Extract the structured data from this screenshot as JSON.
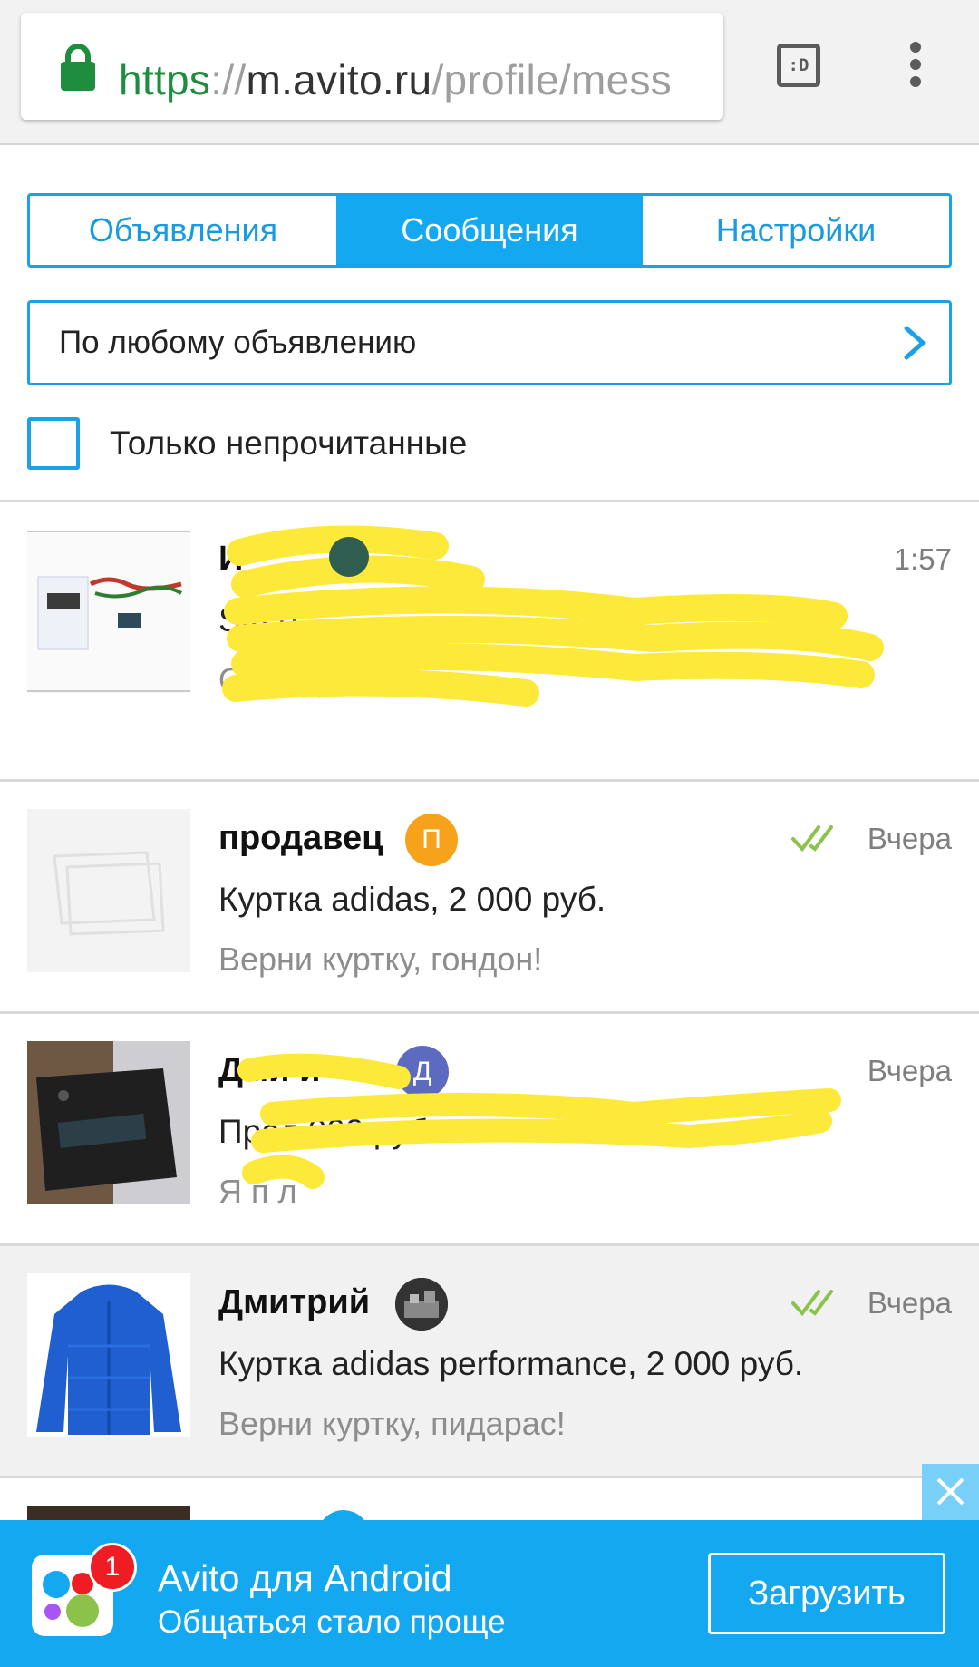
{
  "browser": {
    "url_scheme": "https",
    "url_separator": "://",
    "url_host": "m.avito.ru",
    "url_path": "/profile/mess",
    "tabs_label": ":D"
  },
  "tabs": [
    {
      "label": "Объявления",
      "active": false
    },
    {
      "label": "Сообщения",
      "active": true
    },
    {
      "label": "Настройки",
      "active": false
    }
  ],
  "filter": {
    "label": "По любому объявлению"
  },
  "unread_only": {
    "label": "Только непрочитанные",
    "checked": false
  },
  "messages": [
    {
      "sender": "И",
      "time": "1:57",
      "title": "Sta                                                    б.",
      "preview": "Отл                                                       уда"
    },
    {
      "sender": "продавец",
      "avatar_letter": "П",
      "avatar_color": "#f7a21b",
      "read": true,
      "time": "Вчера",
      "title": "Куртка adidas, 2 000 руб.",
      "preview": "Верни куртку, гондон!"
    },
    {
      "sender": "Дми        й",
      "avatar_letter": "Д",
      "avatar_color": "#5c6bc0",
      "time": "Вчера",
      "title": "Прод                                       000 руб.",
      "preview": "Я п      л"
    },
    {
      "sender": "Дмитрий",
      "avatar_color": "#2b2b2b",
      "read": true,
      "time": "Вчера",
      "title": "Куртка adidas performance, 2 000 руб.",
      "preview": "Верни куртку, пидарас!"
    }
  ],
  "banner": {
    "app_name": "Avito для Android",
    "subtitle": "Общаться стало проще",
    "badge_count": "1",
    "download_label": "Загрузить"
  },
  "colors": {
    "accent": "#14a8f1",
    "check": "#8bc34a",
    "scribble": "#fde93a"
  }
}
